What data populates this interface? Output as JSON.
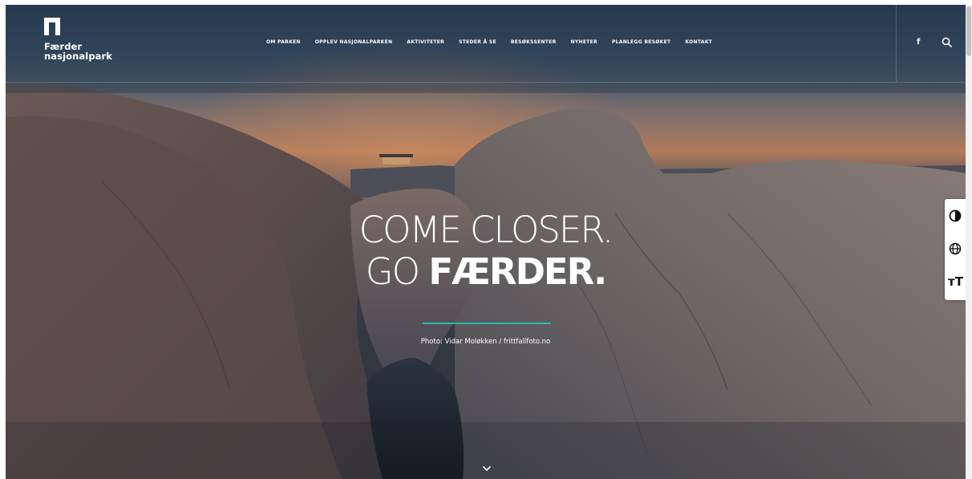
{
  "brand": {
    "line1": "Færder",
    "line2": "nasjonalpark"
  },
  "nav": {
    "items": [
      {
        "label": "OM PARKEN"
      },
      {
        "label": "OPPLEV NASJONALPARKEN"
      },
      {
        "label": "AKTIVITETER"
      },
      {
        "label": "STEDER Å SE"
      },
      {
        "label": "BESØKSSENTER"
      },
      {
        "label": "NYHETER"
      },
      {
        "label": "PLANLEGG BESØKET"
      },
      {
        "label": "KONTAKT"
      }
    ]
  },
  "social": {
    "facebook_icon": "f"
  },
  "icons": [
    "logo-mark-icon",
    "facebook-icon",
    "search-icon",
    "contrast-icon",
    "globe-icon",
    "text-size-icon",
    "chevron-down-icon"
  ],
  "hero": {
    "line1": "COME CLOSER.",
    "line2_light": "GO ",
    "line2_bold": "FÆRDER.",
    "caption": "Photo: Vidar Moløkken / frittfallfoto.no"
  },
  "accessibility": {
    "text_size_label": "тТ"
  },
  "colors": {
    "accent_rule": "#2fb6b3",
    "text": "#ffffff"
  }
}
